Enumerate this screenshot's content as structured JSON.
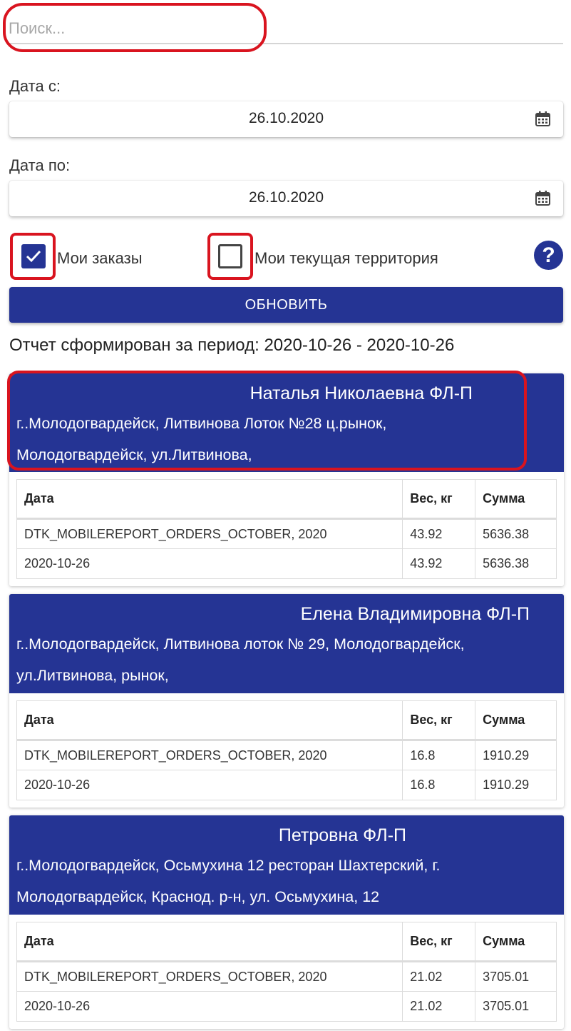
{
  "search": {
    "placeholder": "Поиск..."
  },
  "date_from": {
    "label": "Дата с:",
    "value": "26.10.2020",
    "icon": "calendar-icon"
  },
  "date_to": {
    "label": "Дата по:",
    "value": "26.10.2020",
    "icon": "calendar-icon"
  },
  "filters": {
    "my_orders": {
      "label": "Мои заказы",
      "checked": true
    },
    "my_territory": {
      "label": "Мои текущая территория",
      "checked": false
    },
    "help_icon": "question-circle-icon",
    "help_glyph": "?"
  },
  "refresh_button": {
    "label": "ОБНОВИТЬ"
  },
  "period_text": "Отчет сформирован за период: 2020-10-26 - 2020-10-26",
  "table_headers": {
    "date": "Дата",
    "weight": "Вес, кг",
    "sum": "Сумма"
  },
  "cards": [
    {
      "name": "Наталья Николаевна ФЛ-П",
      "address_line1": "г..Молодогвардейск, Литвинова Лоток №28 ц.рынок,",
      "address_line2": "Молодогвардейск, ул.Литвинова,",
      "rows": [
        {
          "date": "DTK_MOBILEREPORT_ORDERS_OCTOBER, 2020",
          "weight": "43.92",
          "sum": "5636.38"
        },
        {
          "date": "2020-10-26",
          "weight": "43.92",
          "sum": "5636.38"
        }
      ]
    },
    {
      "name": "Елена Владимировна ФЛ-П",
      "address_line1": "г..Молодогвардейск, Литвинова лоток № 29, Молодогвардейск,",
      "address_line2": "ул.Литвинова, рынок,",
      "rows": [
        {
          "date": "DTK_MOBILEREPORT_ORDERS_OCTOBER, 2020",
          "weight": "16.8",
          "sum": "1910.29"
        },
        {
          "date": "2020-10-26",
          "weight": "16.8",
          "sum": "1910.29"
        }
      ]
    },
    {
      "name": "Петровна ФЛ-П",
      "address_line1": "г..Молодогвардейск, Осьмухина 12 ресторан Шахтерский, г.",
      "address_line2": "Молодогвардейск, Краснод. р-н, ул. Осьмухина, 12",
      "rows": [
        {
          "date": "DTK_MOBILEREPORT_ORDERS_OCTOBER, 2020",
          "weight": "21.02",
          "sum": "3705.01"
        },
        {
          "date": "2020-10-26",
          "weight": "21.02",
          "sum": "3705.01"
        }
      ]
    }
  ],
  "colors": {
    "primary": "#253494",
    "highlight": "#d9141f"
  }
}
